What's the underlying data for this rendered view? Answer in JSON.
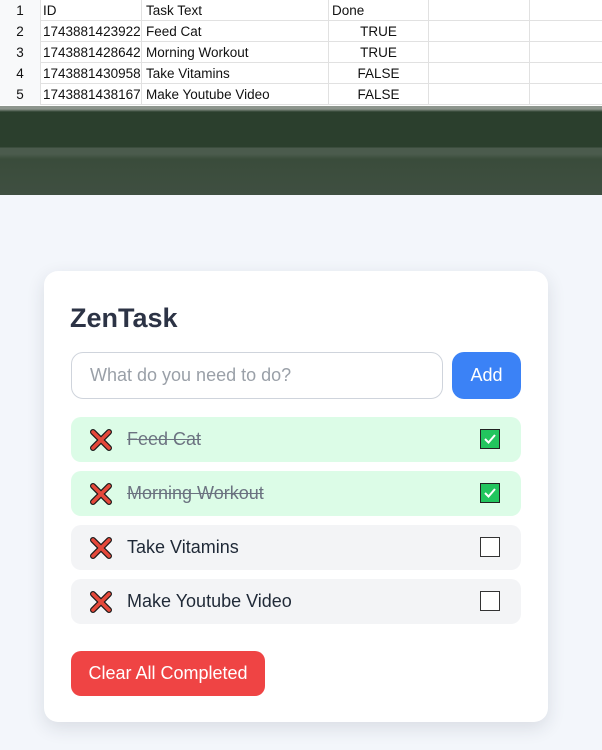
{
  "sheet": {
    "headers": {
      "row": "1",
      "id": "ID",
      "text": "Task Text",
      "done": "Done"
    },
    "rows": [
      {
        "row": "2",
        "id": "1743881423922",
        "text": "Feed Cat",
        "done": "TRUE"
      },
      {
        "row": "3",
        "id": "1743881428642",
        "text": "Morning Workout",
        "done": "TRUE"
      },
      {
        "row": "4",
        "id": "1743881430958",
        "text": "Take Vitamins",
        "done": "FALSE"
      },
      {
        "row": "5",
        "id": "1743881438167",
        "text": "Make Youtube Video",
        "done": "FALSE"
      }
    ]
  },
  "app": {
    "title": "ZenTask",
    "input_placeholder": "What do you need to do?",
    "add_label": "Add",
    "clear_label": "Clear All Completed",
    "tasks": [
      {
        "text": "Feed Cat",
        "done": true
      },
      {
        "text": "Morning Workout",
        "done": true
      },
      {
        "text": "Take Vitamins",
        "done": false
      },
      {
        "text": "Make Youtube Video",
        "done": false
      }
    ]
  },
  "colors": {
    "primary": "#3b82f6",
    "danger": "#ef4444",
    "done_bg": "#dcfce7",
    "check": "#22c55e"
  },
  "icons": {
    "delete": "cross-icon",
    "checked": "check-icon"
  }
}
